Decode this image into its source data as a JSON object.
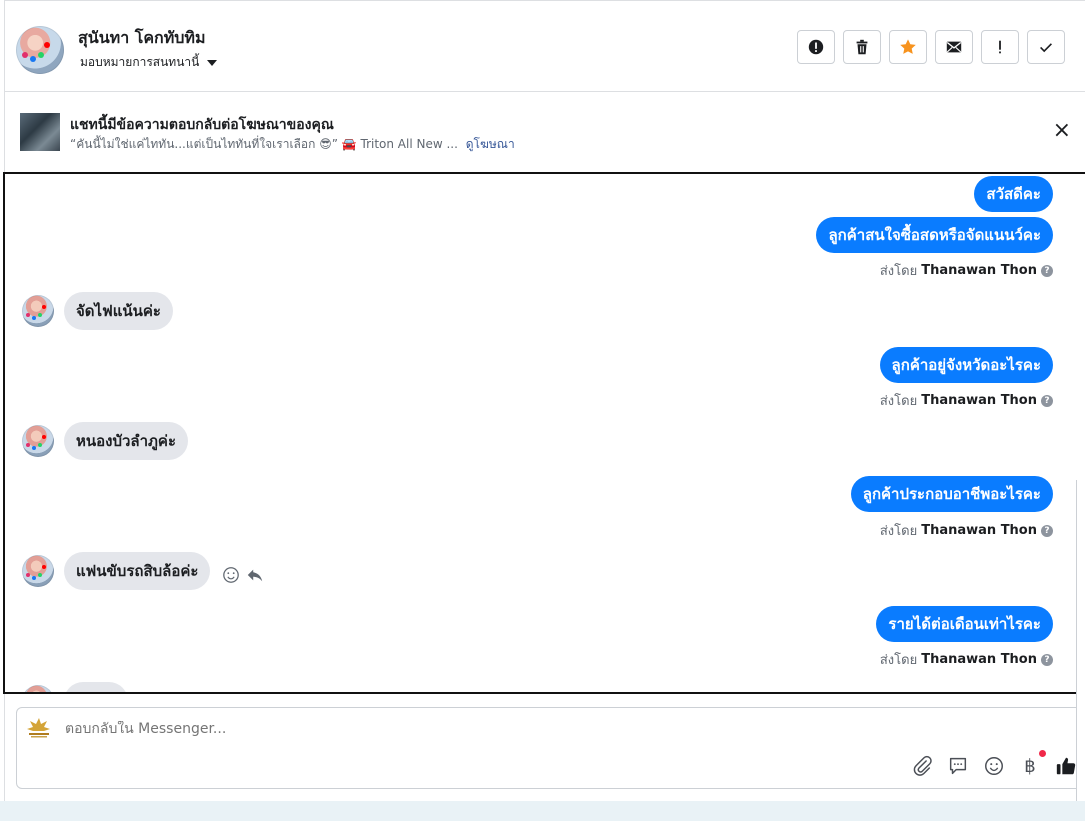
{
  "header": {
    "contact_name": "สุนันทา โคกทับทิม",
    "assign_label": "มอบหมายการสนทนานี้",
    "actions": [
      {
        "name": "mark-spam-button",
        "icon": "alert-circle-icon"
      },
      {
        "name": "delete-button",
        "icon": "trash-icon"
      },
      {
        "name": "star-button",
        "icon": "star-icon",
        "color": "#f7931e"
      },
      {
        "name": "mark-unread-button",
        "icon": "envelope-icon"
      },
      {
        "name": "follow-up-button",
        "icon": "exclamation-icon"
      },
      {
        "name": "mark-done-button",
        "icon": "check-icon"
      }
    ]
  },
  "ad": {
    "title": "แชทนี้มีข้อความตอบกลับต่อโฆษณาของคุณ",
    "snippet": "“คันนี้ไม่ใช่แค่ไททัน...แต่เป็นไททันที่ใจเราเลือก 😎” 🚘 Triton All New ...",
    "link": "ดูโฆษณา",
    "close": "×"
  },
  "messages": {
    "out": [
      {
        "text": "สวัสดีคะ"
      },
      {
        "text": "ลูกค้าสนใจซื้อสดหรือจัดแนนว์คะ",
        "sent_by_prefix": "ส่งโดย",
        "sender": "Thanawan Thon"
      },
      {
        "text": "ลูกค้าอยู่จังหวัดอะไรคะ",
        "sent_by_prefix": "ส่งโดย",
        "sender": "Thanawan Thon"
      },
      {
        "text": "ลูกค้าประกอบอาชีพอะไรคะ",
        "sent_by_prefix": "ส่งโดย",
        "sender": "Thanawan Thon"
      },
      {
        "text": "รายได้ต่อเดือนเท่าไรคะ",
        "sent_by_prefix": "ส่งโดย",
        "sender": "Thanawan Thon"
      }
    ],
    "in": [
      {
        "text": "จัดไฟแน้นค่ะ"
      },
      {
        "text": "หนองบัวลำภูค่ะ"
      },
      {
        "text": "แฟนขับรถสิบล้อค่ะ"
      }
    ]
  },
  "composer": {
    "placeholder": "ตอบกลับใน Messenger...",
    "currency_symbol": "฿",
    "tools": [
      "paperclip-icon",
      "saved-reply-icon",
      "emoji-icon",
      "baht-icon",
      "thumbs-up-icon"
    ]
  }
}
